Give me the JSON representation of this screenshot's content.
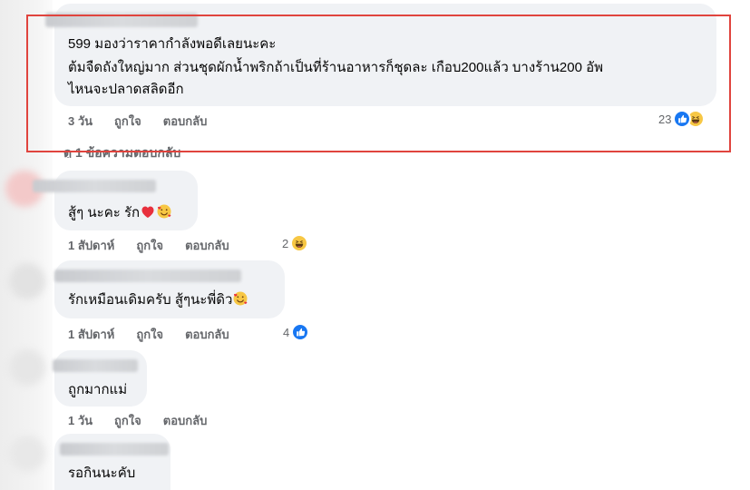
{
  "colors": {
    "bubble": "#f0f2f5",
    "meta_text": "#65676b",
    "highlight_border": "#e0443e",
    "like_blue": "#1877f2",
    "haha_yellow": "#f7c744"
  },
  "main_comment": {
    "lines": [
      "599 มองว่าราคากำลังพอดีเลยนะคะ",
      "ต้มจืดถังใหญ่มาก ส่วนชุดผักน้ำพริกถ้าเป็นที่ร้านอาหารก็ชุดละ เกือบ200แล้ว บางร้าน200 อัพ",
      "ไหนจะปลาดสลิดอีก"
    ],
    "time": "3 วัน",
    "like_label": "ถูกใจ",
    "reply_label": "ตอบกลับ",
    "reaction_count": "23",
    "reaction_icons": [
      "like-icon",
      "haha-icon"
    ]
  },
  "replies_link": "ดู 1 ข้อความตอบกลับ",
  "comments": [
    {
      "text": "สู้ๆ นะคะ รัก",
      "emojis": [
        "red-heart-emoji",
        "smiling-hearts-emoji"
      ],
      "time": "1 สัปดาห์",
      "like_label": "ถูกใจ",
      "reply_label": "ตอบกลับ",
      "reaction_count": "2",
      "reaction_icons": [
        "haha-icon"
      ]
    },
    {
      "text": "รักเหมือนเดิมครับ สู้ๆนะพี่ดิว",
      "emojis": [
        "smiling-hearts-emoji"
      ],
      "time": "1 สัปดาห์",
      "like_label": "ถูกใจ",
      "reply_label": "ตอบกลับ",
      "reaction_count": "4",
      "reaction_icons": [
        "like-icon"
      ]
    },
    {
      "text": "ถูกมากแม่",
      "time": "1 วัน",
      "like_label": "ถูกใจ",
      "reply_label": "ตอบกลับ"
    },
    {
      "text": "รอกินนะคับ"
    }
  ]
}
